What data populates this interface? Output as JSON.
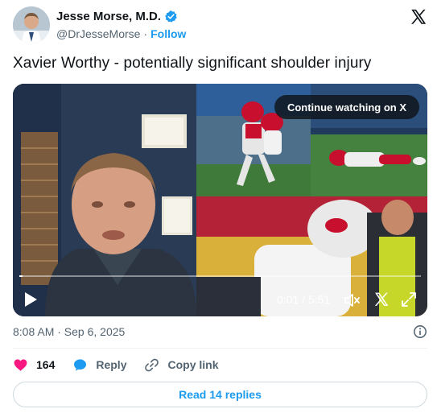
{
  "author": {
    "display_name": "Jesse Morse, M.D.",
    "handle": "@DrJesseMorse",
    "separator": "·",
    "follow_label": "Follow",
    "verified": true
  },
  "tweet": {
    "text": "Xavier Worthy - potentially significant shoulder injury"
  },
  "video": {
    "continue_label": "Continue watching on X",
    "time_display": "0:01 / 5:51",
    "progress_fraction": 0.003
  },
  "meta": {
    "timestamp": "8:08 AM · Sep 6, 2025"
  },
  "actions": {
    "likes": "164",
    "reply_label": "Reply",
    "copy_link_label": "Copy link"
  },
  "read_replies_label": "Read 14 replies",
  "colors": {
    "accent": "#1d9bf0",
    "like": "#f91880",
    "secondary_text": "#536471",
    "border": "#cfd9de"
  },
  "icons": [
    "verified-badge-icon",
    "x-logo-icon",
    "play-icon",
    "volume-icon",
    "x-mark-icon",
    "fullscreen-icon",
    "info-icon",
    "heart-icon",
    "reply-bubble-icon",
    "link-icon"
  ]
}
